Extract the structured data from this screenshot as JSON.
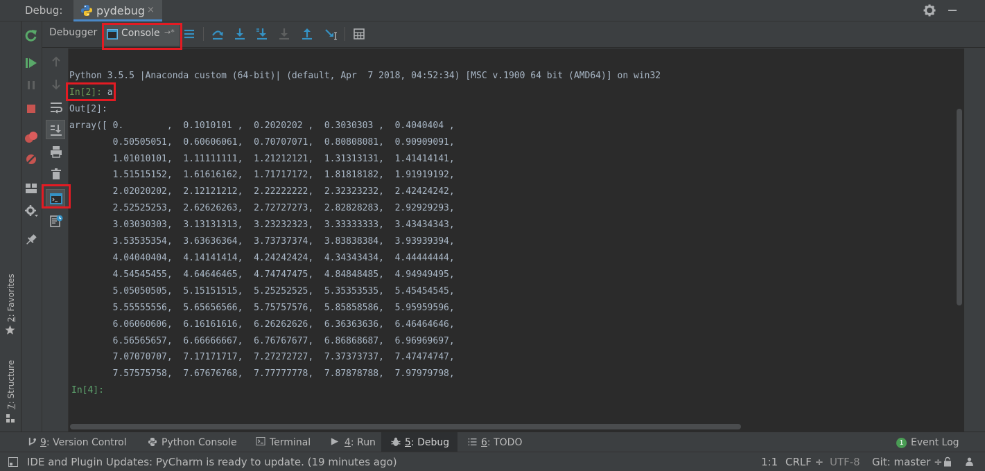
{
  "header": {
    "title_label": "Debug:",
    "tab_label": "pydebug",
    "tab_close": "×"
  },
  "toolbar": {
    "debugger_tab": "Debugger",
    "console_tab": "Console",
    "console_pin": "→*"
  },
  "console": {
    "banner": "Python 3.5.5 |Anaconda custom (64-bit)| (default, Apr  7 2018, 04:52:34) [MSC v.1900 64 bit (AMD64)] on win32",
    "input_prompt": "In[2]:",
    "input_command": " a",
    "output_prompt": "Out[2]:",
    "output_lines": [
      "array([ 0.        ,  0.1010101 ,  0.2020202 ,  0.3030303 ,  0.4040404 ,",
      "        0.50505051,  0.60606061,  0.70707071,  0.80808081,  0.90909091,",
      "        1.01010101,  1.11111111,  1.21212121,  1.31313131,  1.41414141,",
      "        1.51515152,  1.61616162,  1.71717172,  1.81818182,  1.91919192,",
      "        2.02020202,  2.12121212,  2.22222222,  2.32323232,  2.42424242,",
      "        2.52525253,  2.62626263,  2.72727273,  2.82828283,  2.92929293,",
      "        3.03030303,  3.13131313,  3.23232323,  3.33333333,  3.43434343,",
      "        3.53535354,  3.63636364,  3.73737374,  3.83838384,  3.93939394,",
      "        4.04040404,  4.14141414,  4.24242424,  4.34343434,  4.44444444,",
      "        4.54545455,  4.64646465,  4.74747475,  4.84848485,  4.94949495,",
      "        5.05050505,  5.15151515,  5.25252525,  5.35353535,  5.45454545,",
      "        5.55555556,  5.65656566,  5.75757576,  5.85858586,  5.95959596,",
      "        6.06060606,  6.16161616,  6.26262626,  6.36363636,  6.46464646,",
      "        6.56565657,  6.66666667,  6.76767677,  6.86868687,  6.96969697,",
      "        7.07070707,  7.17171717,  7.27272727,  7.37373737,  7.47474747,",
      "        7.57575758,  7.67676768,  7.77777778,  7.87878788,  7.97979798,"
    ],
    "next_prompt": "In[4]:"
  },
  "side_tabs": {
    "favorites_num": "2",
    "favorites_label": ": Favorites",
    "structure_num": "7",
    "structure_label": ": Structure"
  },
  "bottom_tabs": [
    {
      "num": "9",
      "label": ": Version Control"
    },
    {
      "num": "",
      "label": "Python Console"
    },
    {
      "num": "",
      "label": "Terminal"
    },
    {
      "num": "4",
      "label": ": Run"
    },
    {
      "num": "5",
      "label": ": Debug"
    },
    {
      "num": "6",
      "label": ": TODO"
    }
  ],
  "event_log": {
    "badge": "1",
    "label": "Event Log"
  },
  "status": {
    "message": "IDE and Plugin Updates: PyCharm is ready to update. (19 minutes ago)",
    "position": "1:1",
    "line_sep": "CRLF ÷",
    "encoding": "UTF-8",
    "git": "Git: master ÷"
  },
  "colors": {
    "accent_green": "#59a869",
    "stop_red": "#c75450",
    "blue_icon": "#3592c4",
    "highlight": "#e31b23"
  },
  "icons": [
    "rerun-icon",
    "resume-icon",
    "pause-icon",
    "stop-icon",
    "view-breakpoints-icon",
    "mute-breakpoints-icon",
    "restore-layout-icon",
    "settings-icon",
    "pin-icon",
    "up-arrow-icon",
    "down-arrow-icon",
    "soft-wrap-icon",
    "scroll-to-end-icon",
    "print-icon",
    "clear-all-icon",
    "show-console-icon",
    "console-history-icon",
    "threads-icon",
    "step-over-icon",
    "step-into-icon",
    "step-into-my-code-icon",
    "force-step-into-icon",
    "step-out-icon",
    "run-to-cursor-icon",
    "evaluate-expression-icon"
  ]
}
